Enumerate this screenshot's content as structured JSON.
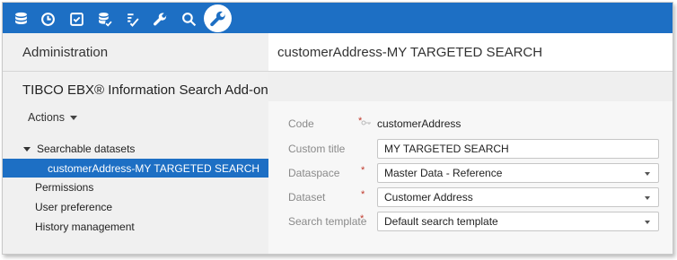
{
  "toolbar": {
    "icons": [
      "database-icon",
      "clock-icon",
      "task-check-icon",
      "database-check-icon",
      "edit-check-icon",
      "wrench-icon",
      "search-icon",
      "wrench-icon-active"
    ]
  },
  "left": {
    "title": "Administration",
    "app_name": "TIBCO EBX® Information Search Add-on",
    "actions_label": "Actions",
    "tree": {
      "group_label": "Searchable datasets",
      "selected_child": "customerAddress-MY TARGETED SEARCH",
      "items": [
        "Permissions",
        "User preference",
        "History management"
      ]
    }
  },
  "right": {
    "title": "customerAddress-MY TARGETED SEARCH",
    "fields": {
      "code": {
        "label": "Code",
        "value": "customerAddress"
      },
      "custom_title": {
        "label": "Custom title",
        "value": "MY TARGETED SEARCH"
      },
      "dataspace": {
        "label": "Dataspace",
        "value": "Master Data - Reference"
      },
      "dataset": {
        "label": "Dataset",
        "value": "Customer Address"
      },
      "search_template": {
        "label": "Search template",
        "value": "Default search template"
      }
    },
    "required_marker": "*"
  },
  "colors": {
    "accent": "#1d6fc4",
    "required": "#c0392b"
  }
}
